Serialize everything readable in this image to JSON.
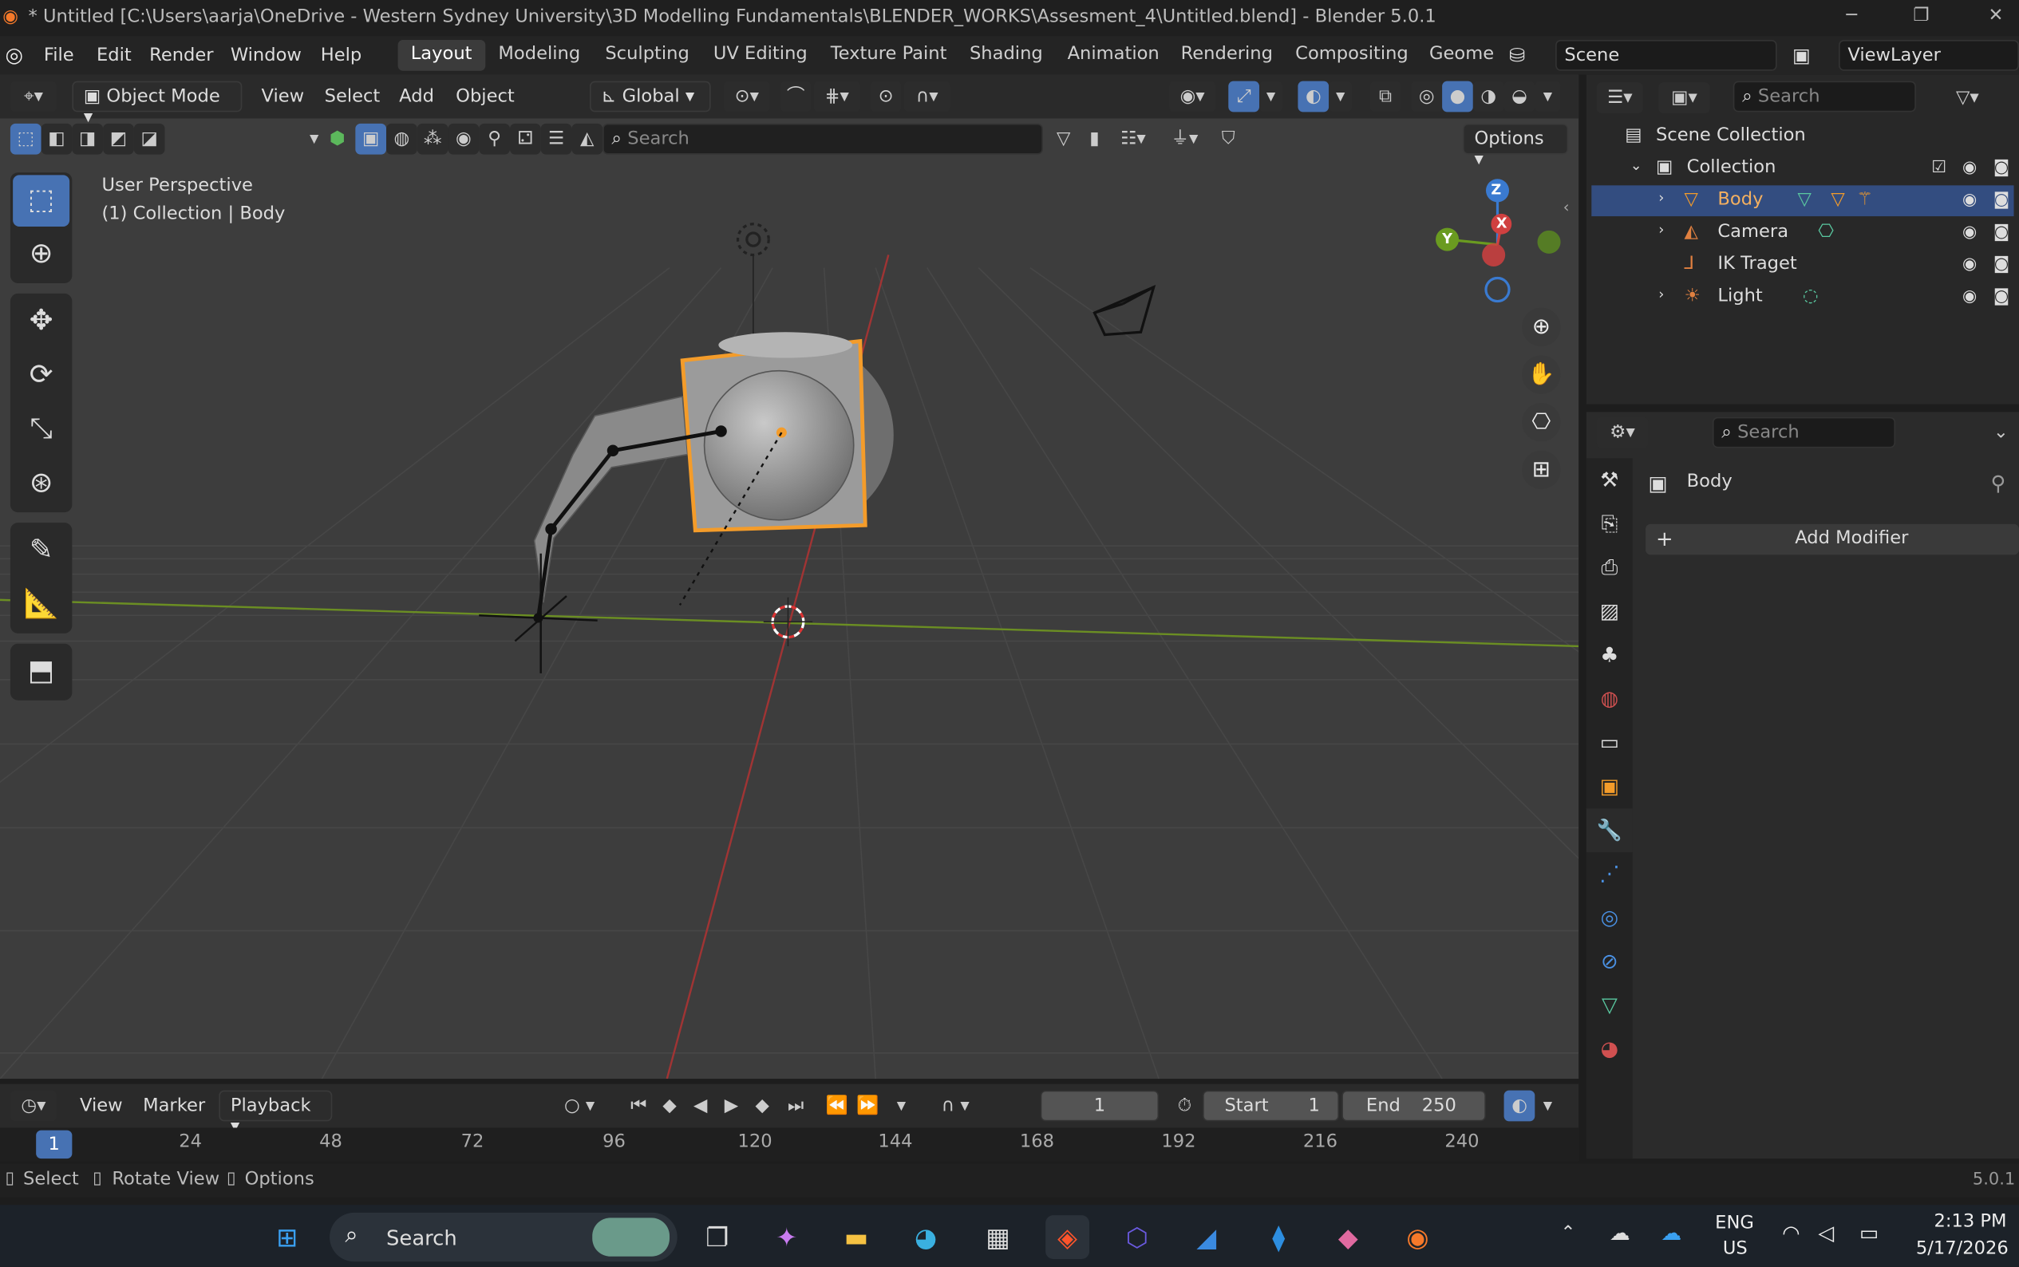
{
  "window": {
    "title": "* Untitled [C:\\Users\\aarja\\OneDrive - Western Sydney University\\3D Modelling Fundamentals\\BLENDER_WORKS\\Assesment_4\\Untitled.blend] - Blender 5.0.1"
  },
  "menus": [
    "File",
    "Edit",
    "Render",
    "Window",
    "Help"
  ],
  "workspaces": [
    "Layout",
    "Modeling",
    "Sculpting",
    "UV Editing",
    "Texture Paint",
    "Shading",
    "Animation",
    "Rendering",
    "Compositing",
    "Geome"
  ],
  "scene": {
    "name": "Scene",
    "view_layer": "ViewLayer"
  },
  "viewport": {
    "mode": "Object Mode",
    "header_menus": [
      "View",
      "Select",
      "Add",
      "Object"
    ],
    "transform_orientation": "Global",
    "search_placeholder": "Search",
    "options_label": "Options",
    "overlay_line1": "User Perspective",
    "overlay_line2": "(1) Collection | Body",
    "gizmo": {
      "z": "Z",
      "x": "X",
      "y": "Y"
    }
  },
  "outliner": {
    "search_placeholder": "Search",
    "root": "Scene Collection",
    "collection": "Collection",
    "items": [
      {
        "label": "Body",
        "selected": true
      },
      {
        "label": "Camera",
        "selected": false
      },
      {
        "label": "IK Traget",
        "selected": false
      },
      {
        "label": "Light",
        "selected": false
      }
    ]
  },
  "properties": {
    "search_placeholder": "Search",
    "object_name": "Body",
    "add_modifier_label": "Add Modifier"
  },
  "timeline": {
    "menus": [
      "View",
      "Marker",
      "Playback"
    ],
    "current_frame": "1",
    "start_label": "Start",
    "start_value": "1",
    "end_label": "End",
    "end_value": "250",
    "ruler": [
      "1",
      "24",
      "48",
      "72",
      "96",
      "120",
      "144",
      "168",
      "192",
      "216",
      "240"
    ]
  },
  "statusbar": {
    "hints": [
      "Select",
      "Rotate View",
      "Options"
    ],
    "version": "5.0.1"
  },
  "taskbar": {
    "search_label": "Search",
    "lang_top": "ENG",
    "lang_bottom": "US",
    "time": "2:13 PM",
    "date": "5/17/2026"
  },
  "colors": {
    "accent": "#4772b3",
    "selection": "#f49c2a",
    "outliner_selected": "#334d80"
  }
}
